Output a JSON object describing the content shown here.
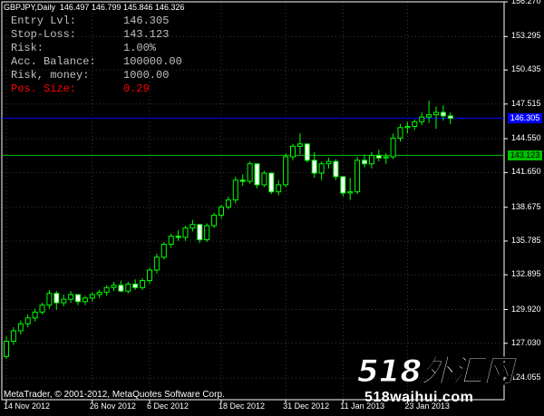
{
  "header": {
    "symbol_timeframe": "GBPJPY,Daily",
    "ohlc": "146.497 146.799 145.846 146.326"
  },
  "info_panel": [
    {
      "label": "Entry Lvl:",
      "value": "146.305",
      "color": "#c0c0c0"
    },
    {
      "label": "Stop-Loss:",
      "value": "143.123",
      "color": "#c0c0c0"
    },
    {
      "label": "Risk:",
      "value": "1.00%",
      "color": "#c0c0c0"
    },
    {
      "label": "Acc. Balance:",
      "value": "100000.00",
      "color": "#c0c0c0"
    },
    {
      "label": "Risk, money:",
      "value": "1000.00",
      "color": "#c0c0c0"
    },
    {
      "label": "Pos. Size:",
      "value": "0.29",
      "color": "#ff0000"
    }
  ],
  "copyright": "MetaTrader, © 2001-2012, MetaQuotes Software Corp.",
  "watermark": {
    "text_cn": "518外汇网",
    "text_url": "518waihui.com"
  },
  "colors": {
    "background": "#000000",
    "grid": "#3a3a3a",
    "bull": "#00ff00",
    "bear": "#ffffff",
    "entry_line": "#0000ff",
    "stop_line": "#00c000",
    "axis": "#ffffff"
  },
  "chart_data": {
    "type": "candlestick",
    "symbol": "GBPJPY",
    "timeframe": "Daily",
    "y_ticks": [
      "156.270",
      "153.295",
      "150.435",
      "147.515",
      "144.550",
      "141.650",
      "138.675",
      "135.785",
      "132.895",
      "129.920",
      "127.030",
      "124.055"
    ],
    "y_tick_values": [
      156.27,
      153.295,
      150.435,
      147.515,
      144.55,
      141.65,
      138.675,
      135.785,
      132.895,
      129.92,
      127.03,
      124.055
    ],
    "ylim": [
      122.2,
      156.27
    ],
    "x_ticks": [
      "14 Nov 2012",
      "26 Nov 2012",
      "6 Dec 2012",
      "18 Dec 2012",
      "31 Dec 2012",
      "11 Jan 2013",
      "23 Jan 2013"
    ],
    "x_tick_index": [
      0,
      12,
      20,
      30,
      39,
      47,
      56
    ],
    "horizontal_lines": [
      {
        "name": "entry",
        "value": 146.305,
        "label": "146.305",
        "color": "#0000ff"
      },
      {
        "name": "stop-loss",
        "value": 143.123,
        "label": "143.123",
        "color": "#00c000"
      }
    ],
    "candles": [
      [
        125.9,
        127.6,
        125.7,
        127.2
      ],
      [
        127.2,
        128.4,
        126.9,
        128.1
      ],
      [
        128.1,
        129.0,
        127.8,
        128.7
      ],
      [
        128.7,
        129.5,
        128.4,
        129.2
      ],
      [
        129.2,
        130.0,
        128.9,
        129.7
      ],
      [
        129.7,
        130.5,
        129.5,
        130.3
      ],
      [
        130.3,
        131.6,
        130.0,
        131.3
      ],
      [
        131.3,
        131.5,
        129.9,
        130.5
      ],
      [
        130.5,
        131.2,
        130.2,
        130.8
      ],
      [
        130.8,
        131.5,
        130.5,
        131.2
      ],
      [
        131.2,
        131.1,
        130.3,
        130.6
      ],
      [
        130.6,
        131.1,
        130.3,
        130.9
      ],
      [
        130.9,
        131.4,
        130.6,
        131.2
      ],
      [
        131.2,
        131.6,
        130.9,
        131.4
      ],
      [
        131.4,
        132.0,
        131.1,
        131.8
      ],
      [
        131.8,
        132.3,
        131.5,
        132.0
      ],
      [
        132.0,
        132.4,
        131.4,
        131.5
      ],
      [
        131.5,
        132.3,
        131.3,
        132.1
      ],
      [
        132.1,
        132.5,
        131.6,
        131.8
      ],
      [
        131.8,
        132.6,
        131.6,
        132.4
      ],
      [
        132.4,
        133.5,
        132.1,
        133.3
      ],
      [
        133.3,
        134.7,
        133.0,
        134.4
      ],
      [
        134.4,
        135.7,
        134.2,
        135.5
      ],
      [
        135.5,
        136.4,
        135.2,
        136.2
      ],
      [
        136.2,
        136.7,
        135.8,
        136.1
      ],
      [
        136.1,
        137.1,
        135.8,
        136.9
      ],
      [
        136.9,
        137.6,
        136.6,
        137.2
      ],
      [
        137.2,
        136.9,
        135.6,
        135.9
      ],
      [
        135.9,
        137.3,
        135.7,
        137.1
      ],
      [
        137.1,
        138.2,
        136.9,
        138.0
      ],
      [
        138.0,
        138.9,
        137.7,
        138.7
      ],
      [
        138.7,
        139.6,
        138.5,
        139.3
      ],
      [
        139.3,
        141.3,
        139.0,
        141.0
      ],
      [
        141.0,
        141.5,
        140.5,
        140.9
      ],
      [
        140.9,
        142.6,
        140.7,
        142.4
      ],
      [
        142.4,
        142.0,
        140.3,
        140.6
      ],
      [
        140.6,
        141.8,
        140.4,
        141.6
      ],
      [
        141.6,
        141.6,
        139.8,
        140.0
      ],
      [
        140.0,
        141.0,
        139.7,
        140.6
      ],
      [
        140.6,
        143.3,
        140.4,
        143.0
      ],
      [
        143.0,
        144.1,
        142.7,
        143.9
      ],
      [
        143.9,
        145.0,
        143.2,
        144.1
      ],
      [
        144.1,
        143.9,
        142.5,
        142.7
      ],
      [
        142.7,
        143.4,
        141.2,
        141.6
      ],
      [
        141.6,
        142.6,
        141.0,
        142.4
      ],
      [
        142.4,
        142.9,
        142.0,
        142.6
      ],
      [
        142.6,
        142.8,
        141.0,
        141.3
      ],
      [
        141.3,
        141.3,
        139.6,
        139.9
      ],
      [
        139.9,
        141.2,
        139.3,
        140.0
      ],
      [
        140.0,
        143.0,
        139.8,
        142.7
      ],
      [
        142.7,
        143.2,
        142.1,
        142.4
      ],
      [
        142.4,
        143.4,
        142.0,
        143.1
      ],
      [
        143.1,
        143.6,
        142.6,
        142.9
      ],
      [
        142.9,
        143.3,
        142.4,
        143.0
      ],
      [
        143.0,
        145.0,
        142.8,
        144.6
      ],
      [
        144.6,
        145.8,
        144.3,
        145.5
      ],
      [
        145.5,
        146.0,
        145.0,
        145.6
      ],
      [
        145.6,
        146.2,
        145.3,
        146.0
      ],
      [
        146.0,
        146.8,
        145.7,
        146.4
      ],
      [
        146.4,
        147.8,
        145.9,
        146.6
      ],
      [
        146.6,
        147.3,
        145.4,
        146.8
      ],
      [
        146.8,
        147.4,
        146.1,
        146.5
      ],
      [
        146.5,
        146.8,
        145.8,
        146.3
      ]
    ]
  }
}
